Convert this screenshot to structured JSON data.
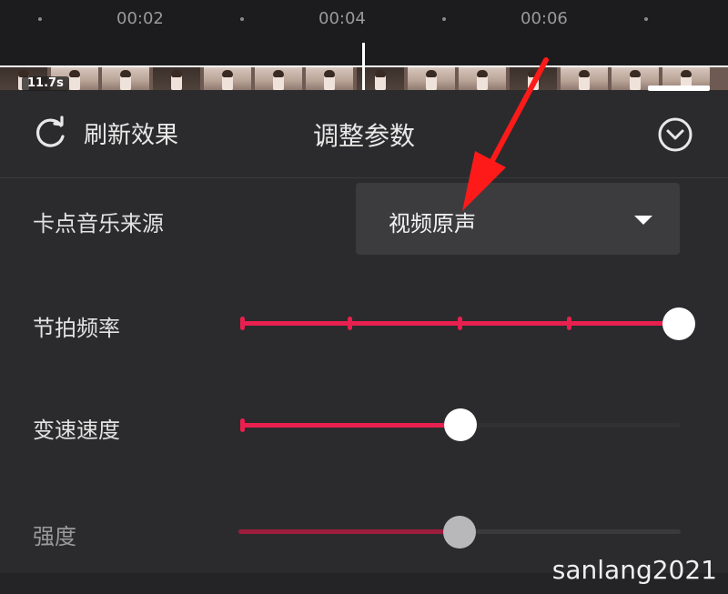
{
  "timeline": {
    "ticks": [
      "00:02",
      "00:04",
      "00:06"
    ],
    "clip_duration": "11.7s"
  },
  "header": {
    "refresh_label": "刷新效果",
    "title": "调整参数"
  },
  "rows": {
    "music_source": {
      "label": "卡点音乐来源",
      "value": "视频原声"
    },
    "beat_frequency": {
      "label": "节拍频率",
      "steps": 5,
      "level": 1.0
    },
    "speed": {
      "label": "变速速度",
      "level": 0.5
    },
    "intensity": {
      "label": "强度",
      "level": 0.5
    }
  },
  "watermark": "sanlang2021",
  "colors": {
    "accent": "#e8204f",
    "annotation_arrow": "#ff1a1a"
  }
}
